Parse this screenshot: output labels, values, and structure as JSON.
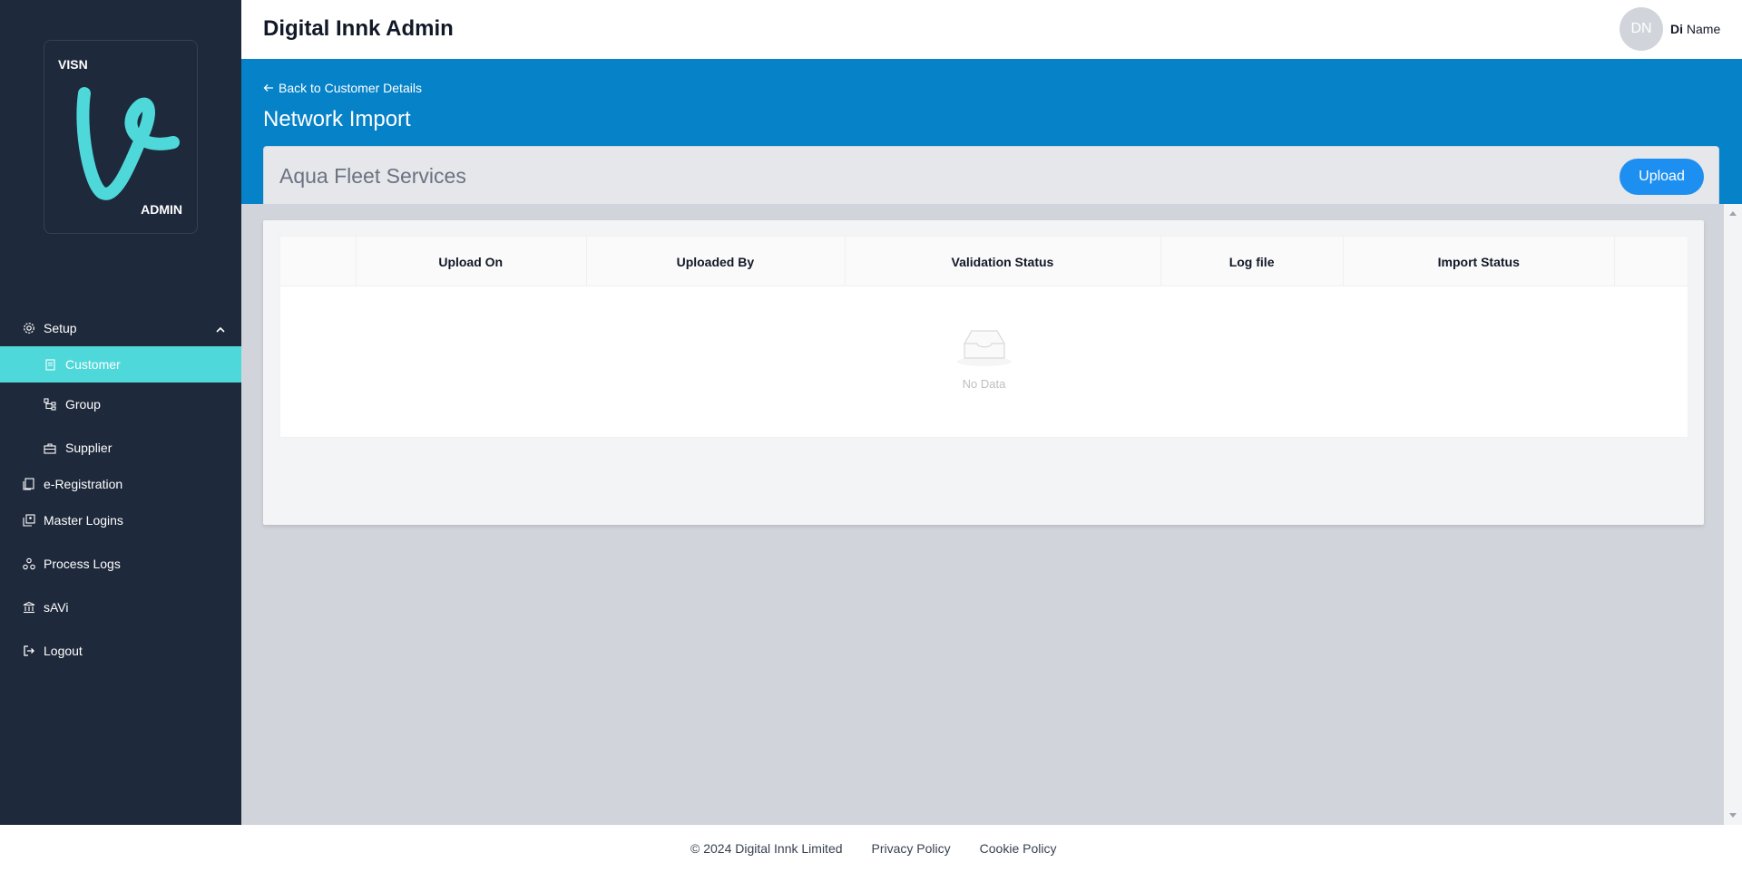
{
  "app": {
    "title": "Digital Innk Admin"
  },
  "logo": {
    "top_text": "VISN",
    "bottom_text": "ADMIN",
    "accent_color": "#4fd8da"
  },
  "user": {
    "initials": "DN",
    "first": "Di",
    "last": "Name"
  },
  "sidebar": {
    "setup": {
      "label": "Setup",
      "icon": "gear-icon",
      "expanded": true
    },
    "sub_items": [
      {
        "label": "Customer",
        "icon": "document-icon",
        "active": true
      },
      {
        "label": "Group",
        "icon": "hierarchy-icon",
        "active": false
      },
      {
        "label": "Supplier",
        "icon": "briefcase-icon",
        "active": false
      }
    ],
    "items": [
      {
        "label": "e-Registration",
        "icon": "register-icon"
      },
      {
        "label": "Master Logins",
        "icon": "logins-icon"
      },
      {
        "label": "Process Logs",
        "icon": "cluster-icon"
      },
      {
        "label": "sAVi",
        "icon": "bank-icon"
      },
      {
        "label": "Logout",
        "icon": "logout-icon"
      }
    ]
  },
  "banner": {
    "back_label": "Back to Customer Details",
    "page_title": "Network Import",
    "color": "#0682c8"
  },
  "customer": {
    "name": "Aqua Fleet Services",
    "upload_label": "Upload"
  },
  "table": {
    "columns": [
      "",
      "Upload On",
      "Uploaded By",
      "Validation Status",
      "Log file",
      "Import Status",
      ""
    ],
    "rows": [],
    "empty_text": "No Data"
  },
  "footer": {
    "copyright": "© 2024 Digital Innk Limited",
    "privacy": "Privacy Policy",
    "cookie": "Cookie Policy"
  }
}
